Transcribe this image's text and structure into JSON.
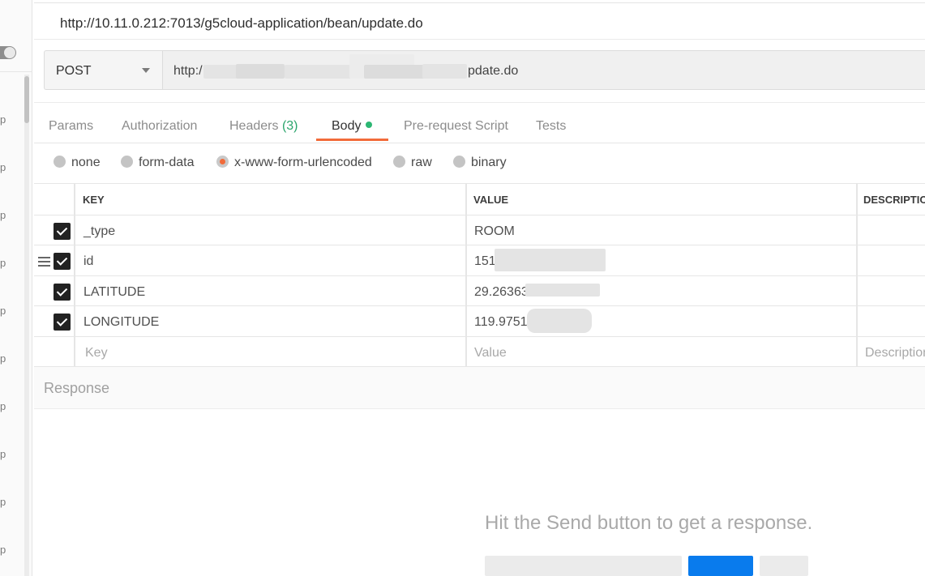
{
  "request": {
    "title": "http://10.11.0.212:7013/g5cloud-application/bean/update.do",
    "method": "POST",
    "url_prefix": "http:/",
    "url_suffix": "pdate.do"
  },
  "sidebar": {
    "item_glyph": "p",
    "items": [
      "p",
      "p",
      "p",
      "p",
      "p",
      "p",
      "p",
      "p",
      "p",
      "p"
    ]
  },
  "tabs": [
    {
      "label": "Params"
    },
    {
      "label": "Authorization"
    },
    {
      "label": "Headers",
      "count": "(3)"
    },
    {
      "label": "Body",
      "active": true,
      "indicator": "green-dot"
    },
    {
      "label": "Pre-request Script"
    },
    {
      "label": "Tests"
    }
  ],
  "body_types": [
    {
      "label": "none",
      "selected": false
    },
    {
      "label": "form-data",
      "selected": false
    },
    {
      "label": "x-www-form-urlencoded",
      "selected": true
    },
    {
      "label": "raw",
      "selected": false
    },
    {
      "label": "binary",
      "selected": false
    }
  ],
  "table": {
    "headers": {
      "key": "KEY",
      "value": "VALUE",
      "description": "DESCRIPTION"
    },
    "rows": [
      {
        "checked": true,
        "key": "_type",
        "value": "ROOM"
      },
      {
        "checked": true,
        "key": "id",
        "value": "151"
      },
      {
        "checked": true,
        "key": "LATITUDE",
        "value": "29.26363"
      },
      {
        "checked": true,
        "key": "LONGITUDE",
        "value": "119.9751"
      }
    ],
    "placeholder": {
      "key": "Key",
      "value": "Value",
      "description": "Description"
    }
  },
  "response": {
    "label": "Response",
    "empty_message": "Hit the Send button to get a response."
  },
  "colors": {
    "accent": "#f26b3a",
    "body_dot": "#2cb673",
    "headers_count": "#2aa56c",
    "send_button": "#097bed"
  }
}
